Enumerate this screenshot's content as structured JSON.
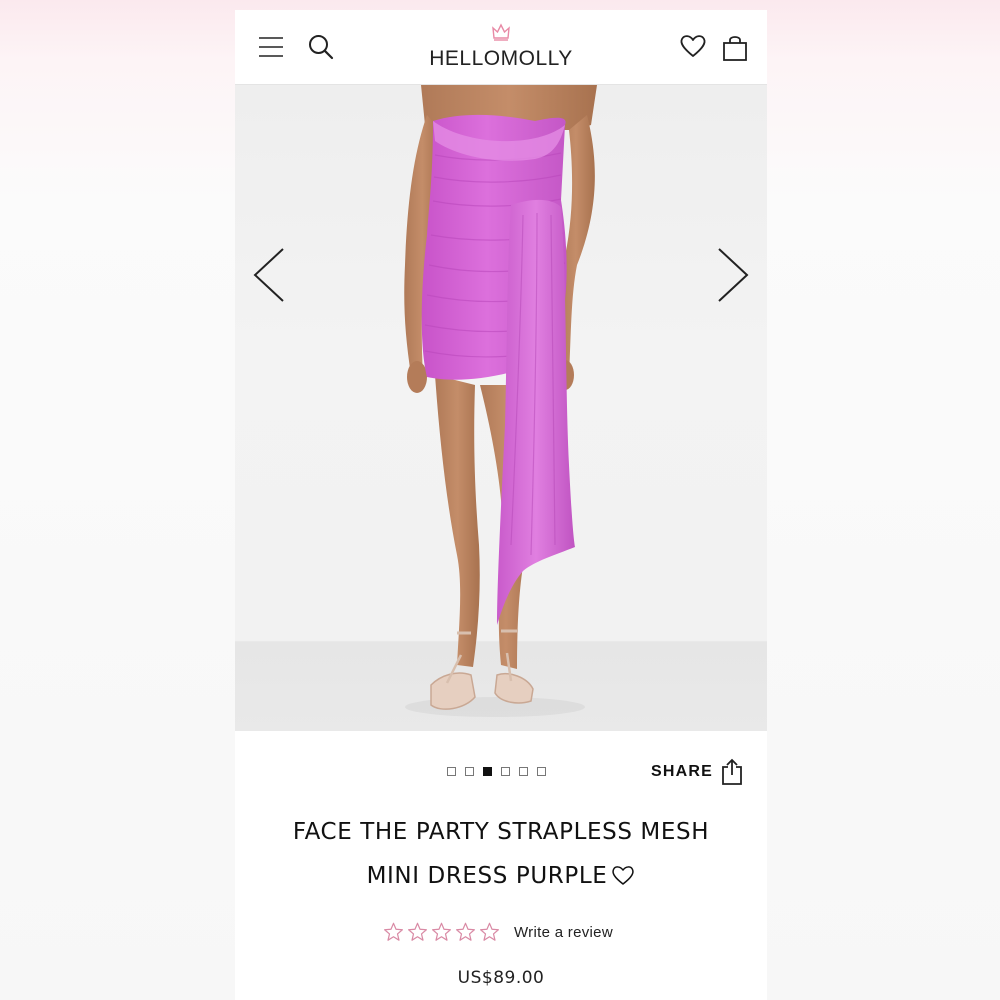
{
  "header": {
    "logo_text": "HELLOMOLLY",
    "menu_icon": "menu-icon",
    "search_icon": "search-icon",
    "wishlist_icon": "heart-icon",
    "bag_icon": "shopping-bag-icon"
  },
  "gallery": {
    "dress_color": "#d86ad9",
    "prev_icon": "chevron-left-icon",
    "next_icon": "chevron-right-icon",
    "image_count": 6,
    "active_index": 2
  },
  "share": {
    "label": "SHARE",
    "icon": "share-icon"
  },
  "product": {
    "title_line1": "FACE THE PARTY STRAPLESS MESH",
    "title_line2": "MINI DRESS PURPLE",
    "rating_stars": 0,
    "rating_max": 5,
    "review_link": "Write a review",
    "price": "US$89.00"
  },
  "colors": {
    "brand_pink": "#e88aa6",
    "star_outline": "#d98aa5",
    "text": "#111111"
  }
}
